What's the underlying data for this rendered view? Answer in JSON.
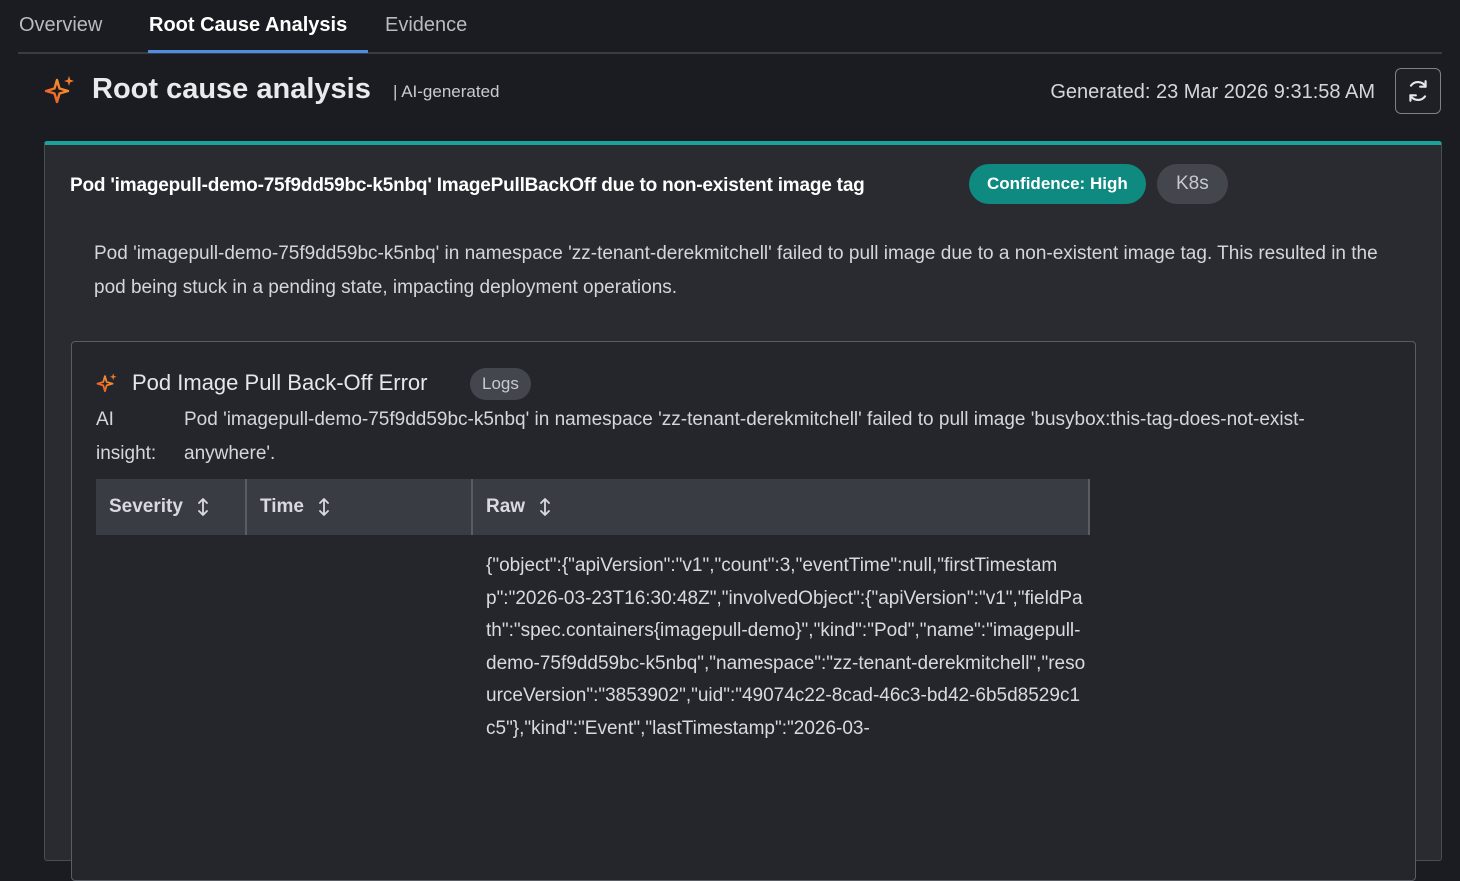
{
  "tabs": [
    {
      "label": "Overview",
      "active": false
    },
    {
      "label": "Root Cause Analysis",
      "active": true
    },
    {
      "label": "Evidence",
      "active": false
    }
  ],
  "header": {
    "title": "Root cause analysis",
    "ai_tag": "| AI-generated",
    "generated": "Generated: 23 Mar 2026 9:31:58 AM",
    "icons": {
      "title": "sparkle-icon",
      "refresh": "refresh-icon"
    }
  },
  "finding": {
    "title": "Pod 'imagepull-demo-75f9dd59bc-k5nbq' ImagePullBackOff due to non-existent image tag",
    "confidence": "Confidence: High",
    "category": "K8s",
    "summary": "Pod 'imagepull-demo-75f9dd59bc-k5nbq' in namespace 'zz-tenant-derekmitchell' failed to pull image due to a non-existent image tag. This resulted in the pod being stuck in a pending state, impacting deployment operations."
  },
  "evidence": {
    "title": "Pod Image Pull Back-Off Error",
    "source": "Logs",
    "insight_label": "AI insight:",
    "insight_text": "Pod 'imagepull-demo-75f9dd59bc-k5nbq' in namespace 'zz-tenant-derekmitchell' failed to pull image 'busybox:this-tag-does-not-exist-anywhere'.",
    "table": {
      "columns": [
        "Severity",
        "Time",
        "Raw"
      ],
      "rows": [
        {
          "severity": "",
          "time": "",
          "raw": "{\"object\":{\"apiVersion\":\"v1\",\"count\":3,\"eventTime\":null,\"firstTimestamp\":\"2026-03-23T16:30:48Z\",\"involvedObject\":{\"apiVersion\":\"v1\",\"fieldPath\":\"spec.containers{imagepull-demo}\",\"kind\":\"Pod\",\"name\":\"imagepull-demo-75f9dd59bc-k5nbq\",\"namespace\":\"zz-tenant-derekmitchell\",\"resourceVersion\":\"3853902\",\"uid\":\"49074c22-8cad-46c3-bd42-6b5d8529c1c5\"},\"kind\":\"Event\",\"lastTimestamp\":\"2026-03-"
        }
      ]
    }
  },
  "colors": {
    "background": "#1b1c21",
    "accent_tab": "#4f8de0",
    "card_accent": "#1aa39a",
    "confidence_badge": "#0e8a80",
    "sparkle": "#f05a28"
  }
}
